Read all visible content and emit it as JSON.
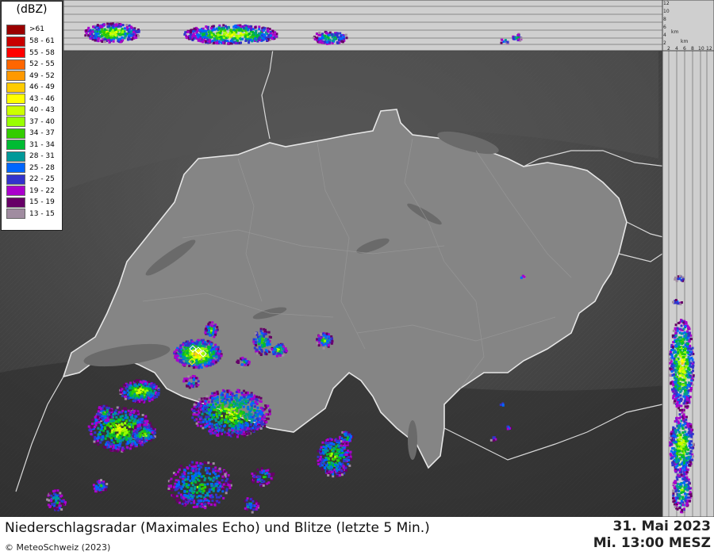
{
  "legend": {
    "title": "(dBZ)",
    "entries": [
      {
        "label": ">61",
        "color": "#9a0000"
      },
      {
        "label": "58 - 61",
        "color": "#c80000"
      },
      {
        "label": "55 - 58",
        "color": "#ff0000"
      },
      {
        "label": "52 - 55",
        "color": "#ff6600"
      },
      {
        "label": "49 - 52",
        "color": "#ff9900"
      },
      {
        "label": "46 - 49",
        "color": "#ffcc00"
      },
      {
        "label": "43 - 46",
        "color": "#ffff00"
      },
      {
        "label": "40 - 43",
        "color": "#ccff00"
      },
      {
        "label": "37 - 40",
        "color": "#99ff00"
      },
      {
        "label": "34 - 37",
        "color": "#33cc00"
      },
      {
        "label": "31 - 34",
        "color": "#00bb33"
      },
      {
        "label": "28 - 31",
        "color": "#009999"
      },
      {
        "label": "25 - 28",
        "color": "#0066ff"
      },
      {
        "label": "22 - 25",
        "color": "#3333cc"
      },
      {
        "label": "19 - 22",
        "color": "#aa00cc"
      },
      {
        "label": "15 - 19",
        "color": "#660066"
      },
      {
        "label": "13 - 15",
        "color": "#a08ca0"
      }
    ]
  },
  "profile_top": {
    "axis_ticks": [
      "12",
      "10",
      "8",
      "6",
      "4",
      "2"
    ],
    "unit": "km"
  },
  "profile_right": {
    "axis_ticks": [
      "2",
      "4",
      "6",
      "8",
      "10",
      "12"
    ],
    "unit": "km"
  },
  "footer": {
    "title": "Niederschlagsradar (Maximales Echo) und Blitze (letzte 5 Min.)",
    "copyright": "© MeteoSchweiz (2023)",
    "date": "31. Mai 2023",
    "time": "Mi. 13:00 MESZ"
  },
  "colors": {
    "terrain_dark": "#3b3b3b",
    "terrain_light": "#6e6e6e",
    "switzerland_fill": "#8a8a8a",
    "border": "#e0e0e0"
  }
}
